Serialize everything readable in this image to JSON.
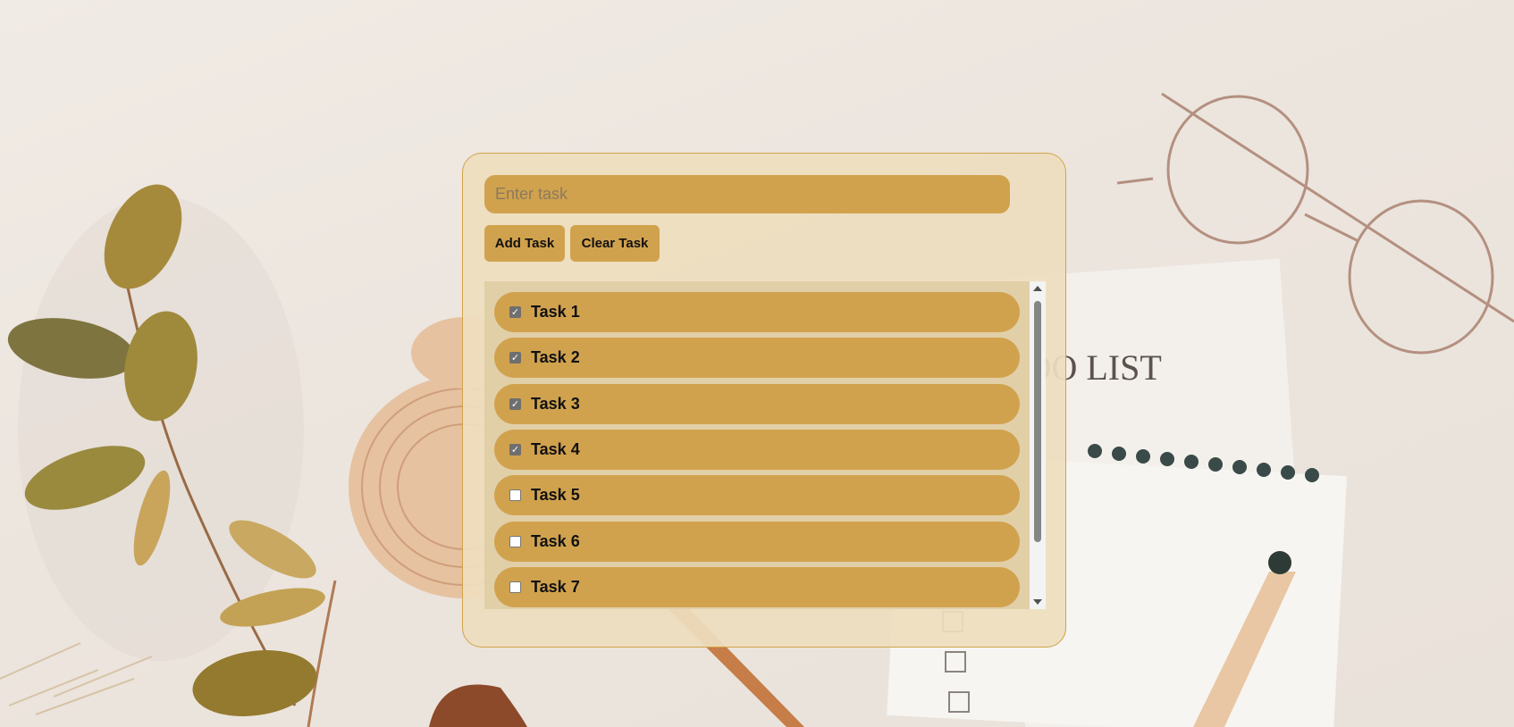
{
  "input": {
    "value": "",
    "placeholder": "Enter task"
  },
  "buttons": {
    "add_label": "Add Task",
    "clear_label": "Clear Task"
  },
  "tasks": [
    {
      "label": "Task 1",
      "checked": true
    },
    {
      "label": "Task 2",
      "checked": true
    },
    {
      "label": "Task 3",
      "checked": true
    },
    {
      "label": "Task 4",
      "checked": true
    },
    {
      "label": "Task 5",
      "checked": false
    },
    {
      "label": "Task 6",
      "checked": false
    },
    {
      "label": "Task 7",
      "checked": false
    }
  ],
  "background_text": "TO DO LIST",
  "colors": {
    "accent": "#d1a24e",
    "panel": "#eedebe",
    "panel_border": "#d1a247",
    "list_bg": "#e1cfa8"
  }
}
